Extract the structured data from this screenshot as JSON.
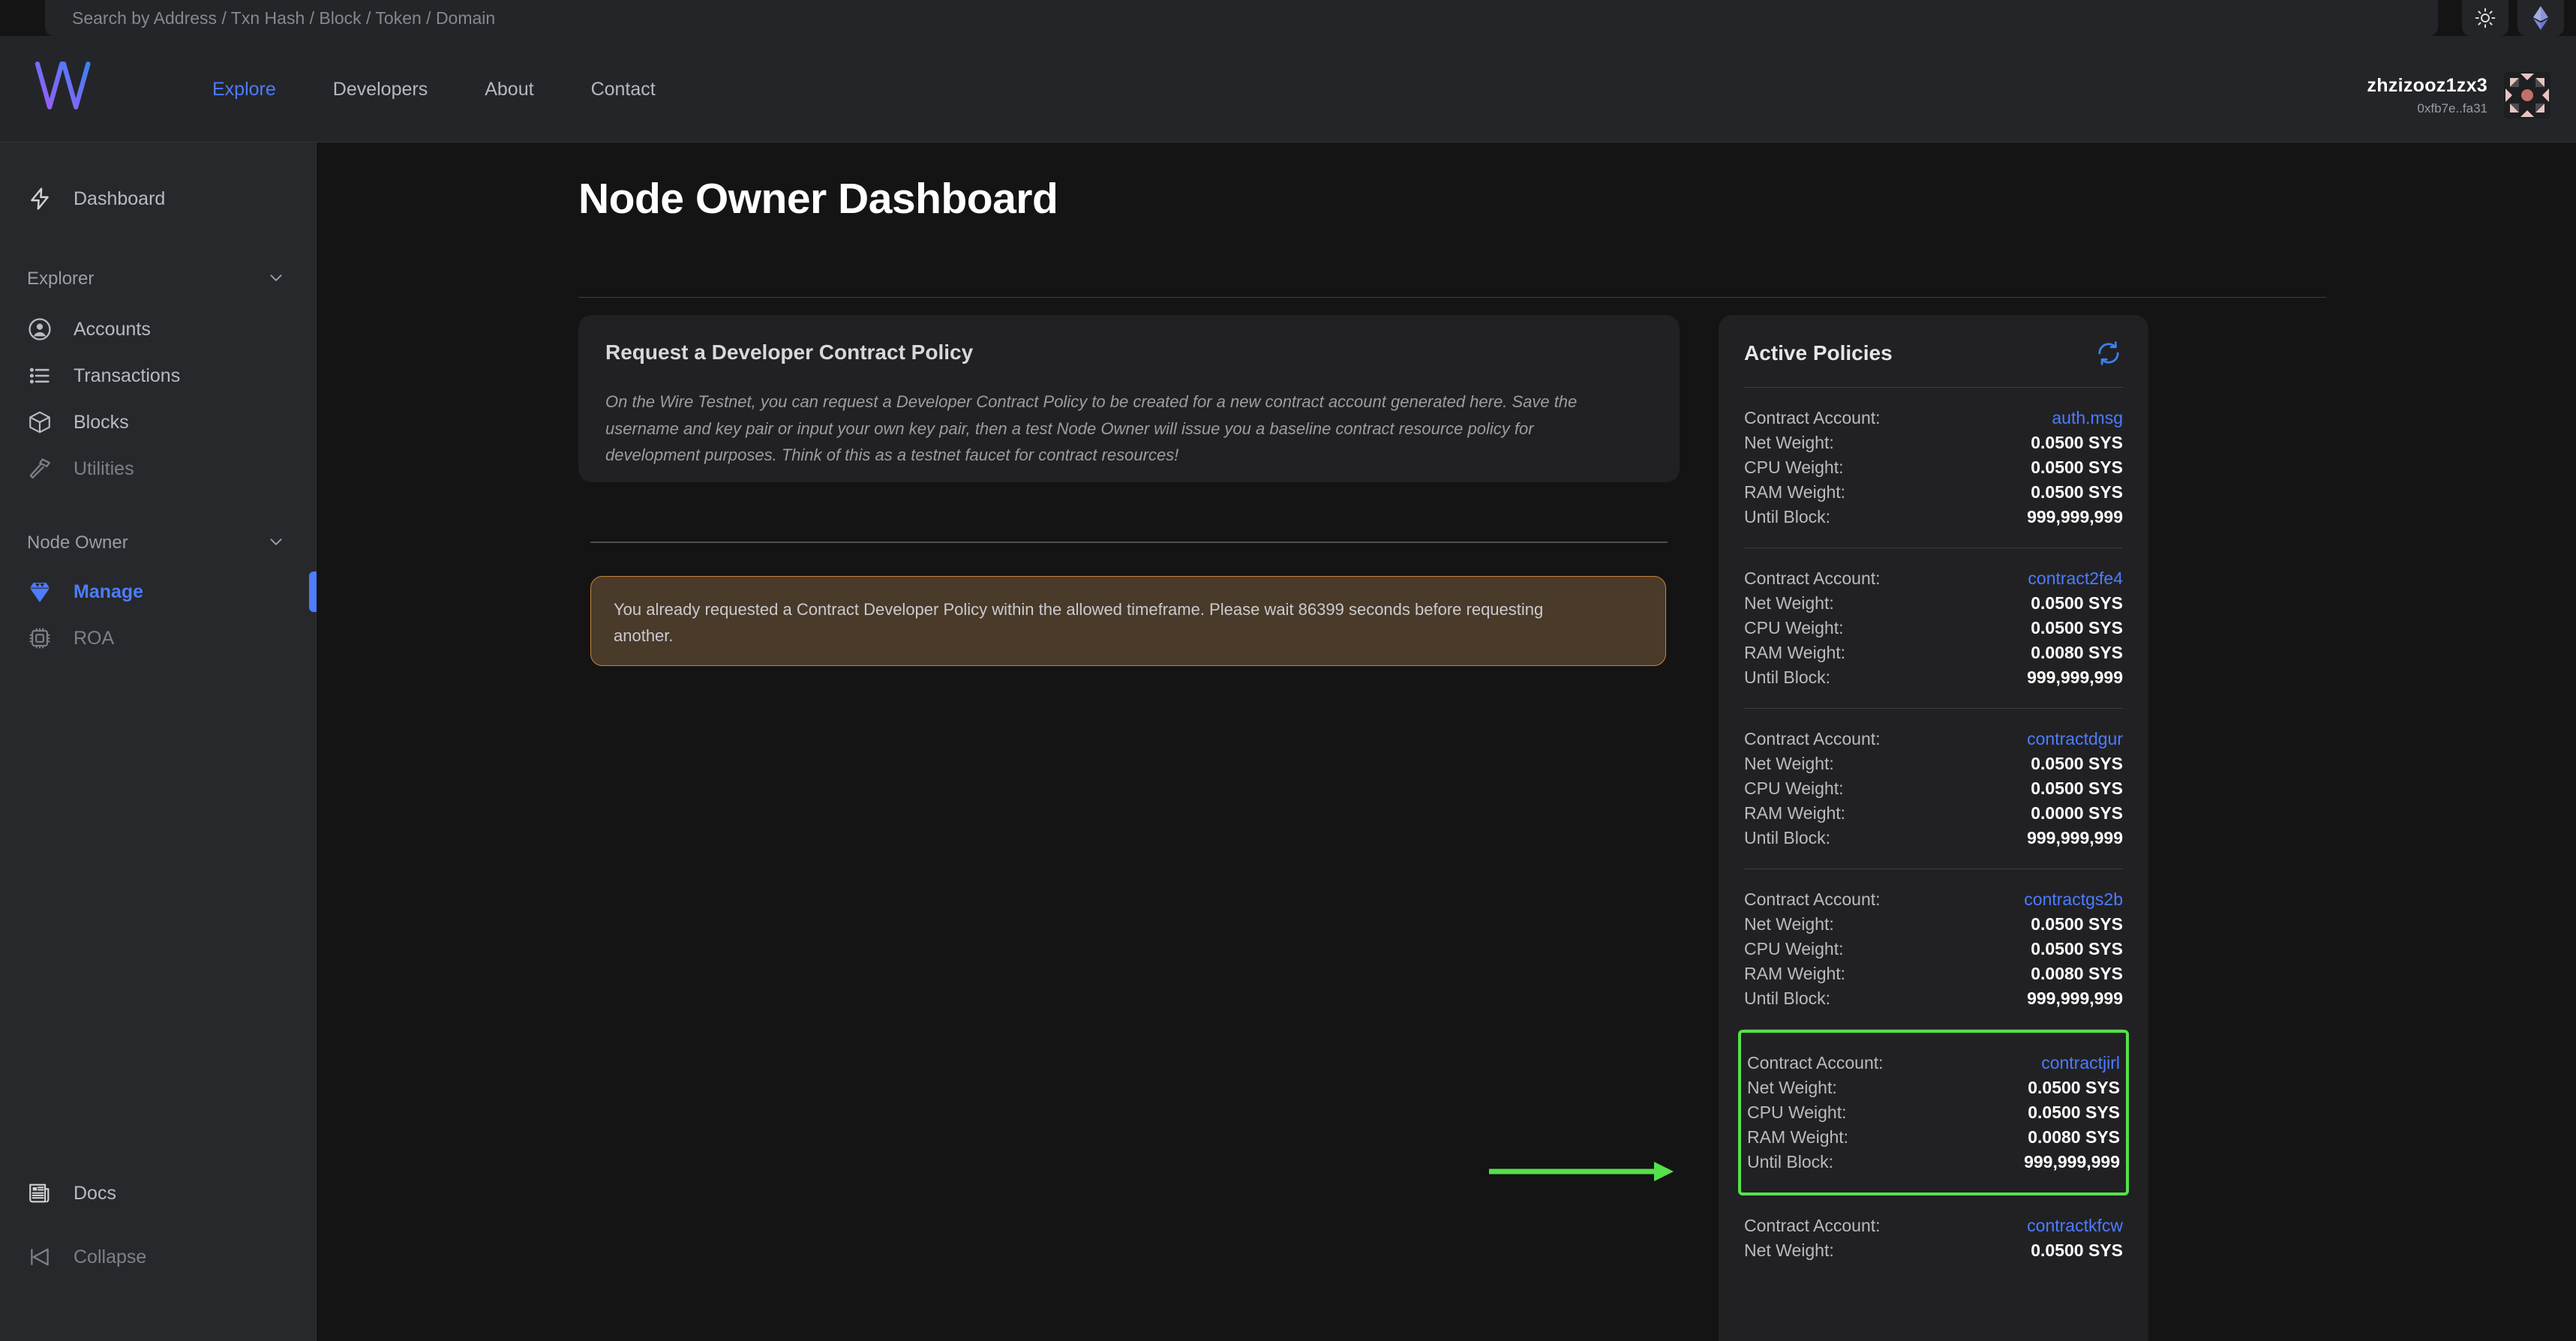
{
  "search": {
    "placeholder": "Search by Address / Txn Hash / Block / Token / Domain",
    "value": ""
  },
  "topbar": {
    "theme_icon": "sun-icon",
    "chain_icon": "ethereum-icon"
  },
  "header": {
    "logo": "wire-logo",
    "nav": [
      {
        "label": "Explore",
        "active": true
      },
      {
        "label": "Developers",
        "active": false
      },
      {
        "label": "About",
        "active": false
      },
      {
        "label": "Contact",
        "active": false
      }
    ],
    "user": {
      "name": "zhzizooz1zx3",
      "address": "0xfb7e..fa31",
      "avatar": "identicon-avatar"
    }
  },
  "sidebar": {
    "top_item": {
      "label": "Dashboard",
      "icon": "lightning-icon"
    },
    "groups": [
      {
        "label": "Explorer",
        "icon": "chevron-down-icon",
        "items": [
          {
            "label": "Accounts",
            "icon": "user-circle-icon",
            "state": "normal"
          },
          {
            "label": "Transactions",
            "icon": "list-icon",
            "state": "normal"
          },
          {
            "label": "Blocks",
            "icon": "cube-icon",
            "state": "normal"
          },
          {
            "label": "Utilities",
            "icon": "hammer-icon",
            "state": "muted"
          }
        ]
      },
      {
        "label": "Node Owner",
        "icon": "chevron-down-icon",
        "items": [
          {
            "label": "Manage",
            "icon": "diamond-icon",
            "state": "active"
          },
          {
            "label": "ROA",
            "icon": "chip-icon",
            "state": "muted"
          }
        ]
      }
    ],
    "bottom_items": [
      {
        "label": "Docs",
        "icon": "newspaper-icon",
        "state": "normal"
      },
      {
        "label": "Collapse",
        "icon": "collapse-icon",
        "state": "muted"
      }
    ]
  },
  "main": {
    "page_title": "Node Owner Dashboard",
    "request_card": {
      "title": "Request a Developer Contract Policy",
      "body": "On the Wire Testnet, you can request a Developer Contract Policy to be created for a new contract account generated here. Save the username and key pair or input your own key pair, then a test Node Owner will issue you a baseline contract resource policy for development purposes. Think of this as a testnet faucet for contract resources!",
      "alert": "You already requested a Contract Developer Policy within the allowed timeframe. Please wait 86399 seconds before requesting another."
    },
    "active_policies": {
      "title": "Active Policies",
      "refresh_icon": "refresh-icon",
      "labels": {
        "contract_account": "Contract Account:",
        "net_weight": "Net Weight:",
        "cpu_weight": "CPU Weight:",
        "ram_weight": "RAM Weight:",
        "until_block": "Until Block:"
      },
      "items": [
        {
          "account": "auth.msg",
          "net": "0.0500 SYS",
          "cpu": "0.0500 SYS",
          "ram": "0.0500 SYS",
          "until": "999,999,999",
          "highlight": false
        },
        {
          "account": "contract2fe4",
          "net": "0.0500 SYS",
          "cpu": "0.0500 SYS",
          "ram": "0.0080 SYS",
          "until": "999,999,999",
          "highlight": false
        },
        {
          "account": "contractdgur",
          "net": "0.0500 SYS",
          "cpu": "0.0500 SYS",
          "ram": "0.0000 SYS",
          "until": "999,999,999",
          "highlight": false
        },
        {
          "account": "contractgs2b",
          "net": "0.0500 SYS",
          "cpu": "0.0500 SYS",
          "ram": "0.0080 SYS",
          "until": "999,999,999",
          "highlight": false
        },
        {
          "account": "contractjirl",
          "net": "0.0500 SYS",
          "cpu": "0.0500 SYS",
          "ram": "0.0080 SYS",
          "until": "999,999,999",
          "highlight": true
        },
        {
          "account": "contractkfcw",
          "net": "0.0500 SYS",
          "cpu": "",
          "ram": "",
          "until": "",
          "highlight": false
        }
      ]
    }
  },
  "annotation": {
    "arrow_icon": "arrow-right-annotation",
    "color": "#55e14a"
  }
}
